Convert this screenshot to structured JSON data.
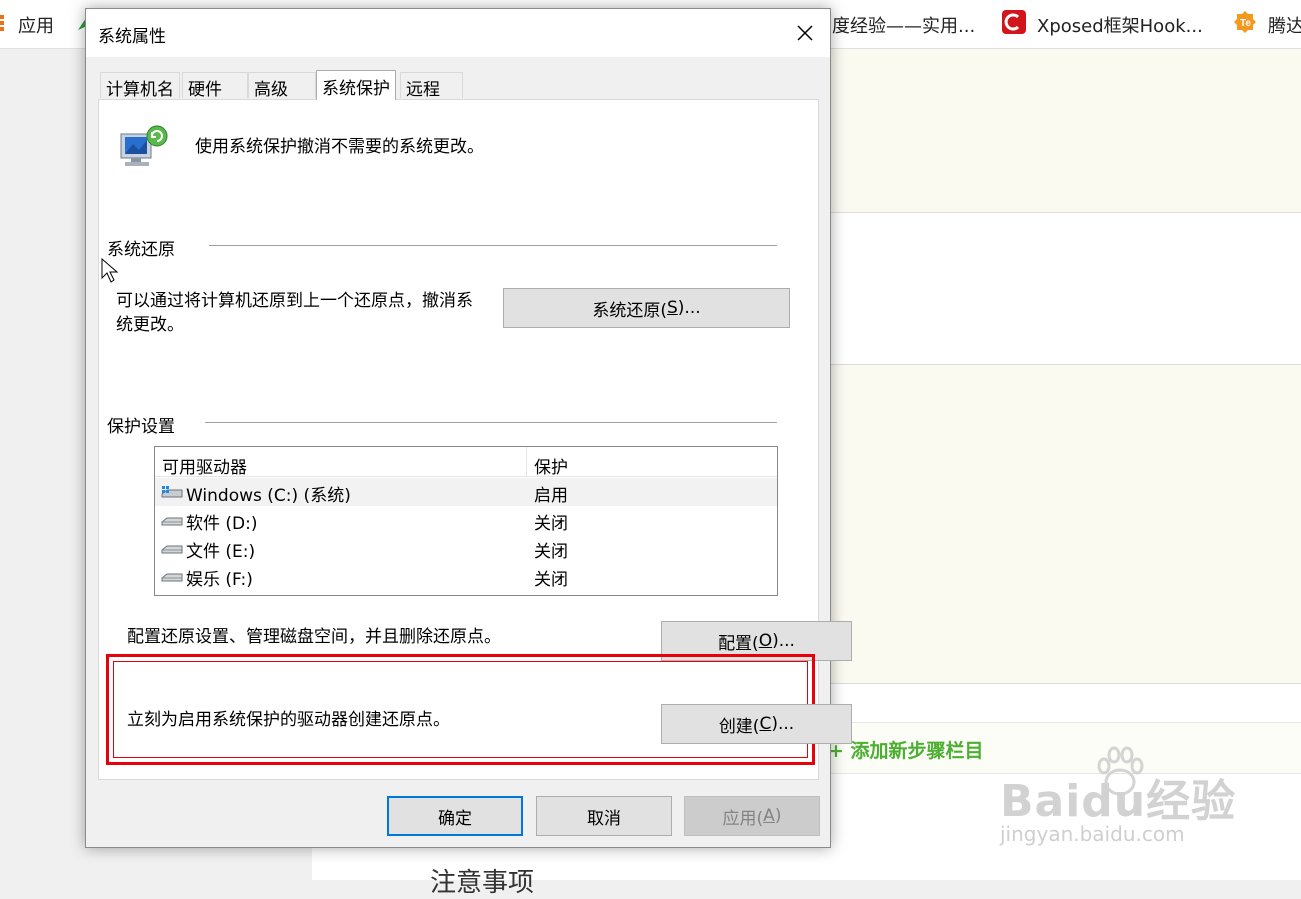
{
  "browser": {
    "bookmarks": [
      {
        "label": "应用"
      },
      {
        "label": "度经验——实用..."
      },
      {
        "label": "Xposed框架Hook..."
      },
      {
        "label": "腾达"
      }
    ]
  },
  "page": {
    "add_step": "+ 添加新步骤栏目",
    "watermark_main": "Baidu经验",
    "watermark_sub": "jingyan.baidu.com",
    "footer_heading": "注意事项"
  },
  "dialog": {
    "title": "系统属性",
    "tabs": [
      {
        "label": "计算机名",
        "active": false
      },
      {
        "label": "硬件",
        "active": false
      },
      {
        "label": "高级",
        "active": false
      },
      {
        "label": "系统保护",
        "active": true
      },
      {
        "label": "远程",
        "active": false
      }
    ],
    "intro_text": "使用系统保护撤消不需要的系统更改。",
    "restore_group": {
      "title": "系统还原",
      "desc_line1": "可以通过将计算机还原到上一个还原点，撤消系",
      "desc_line2": "统更改。",
      "button_label": "系统还原(",
      "button_key": "S",
      "button_suffix": ")..."
    },
    "protection_group": {
      "title": "保护设置",
      "columns": [
        "可用驱动器",
        "保护"
      ],
      "drives": [
        {
          "name": "Windows  (C:) (系统)",
          "status": "启用",
          "icon": "system-drive-icon",
          "selected": true
        },
        {
          "name": "软件 (D:)",
          "status": "关闭",
          "icon": "drive-icon",
          "selected": false
        },
        {
          "name": "文件 (E:)",
          "status": "关闭",
          "icon": "drive-icon",
          "selected": false
        },
        {
          "name": "娱乐 (F:)",
          "status": "关闭",
          "icon": "drive-icon",
          "selected": false
        }
      ],
      "configure_text": "配置还原设置、管理磁盘空间，并且删除还原点。",
      "configure_label": "配置(",
      "configure_key": "O",
      "configure_suffix": ")...",
      "create_text": "立刻为启用系统保护的驱动器创建还原点。",
      "create_label": "创建(",
      "create_key": "C",
      "create_suffix": ")..."
    },
    "buttons": {
      "ok": "确定",
      "cancel": "取消",
      "apply_label": "应用(",
      "apply_key": "A",
      "apply_suffix": ")"
    },
    "colors": {
      "highlight": "#e8000b",
      "default_button_border": "#0078d7"
    }
  }
}
